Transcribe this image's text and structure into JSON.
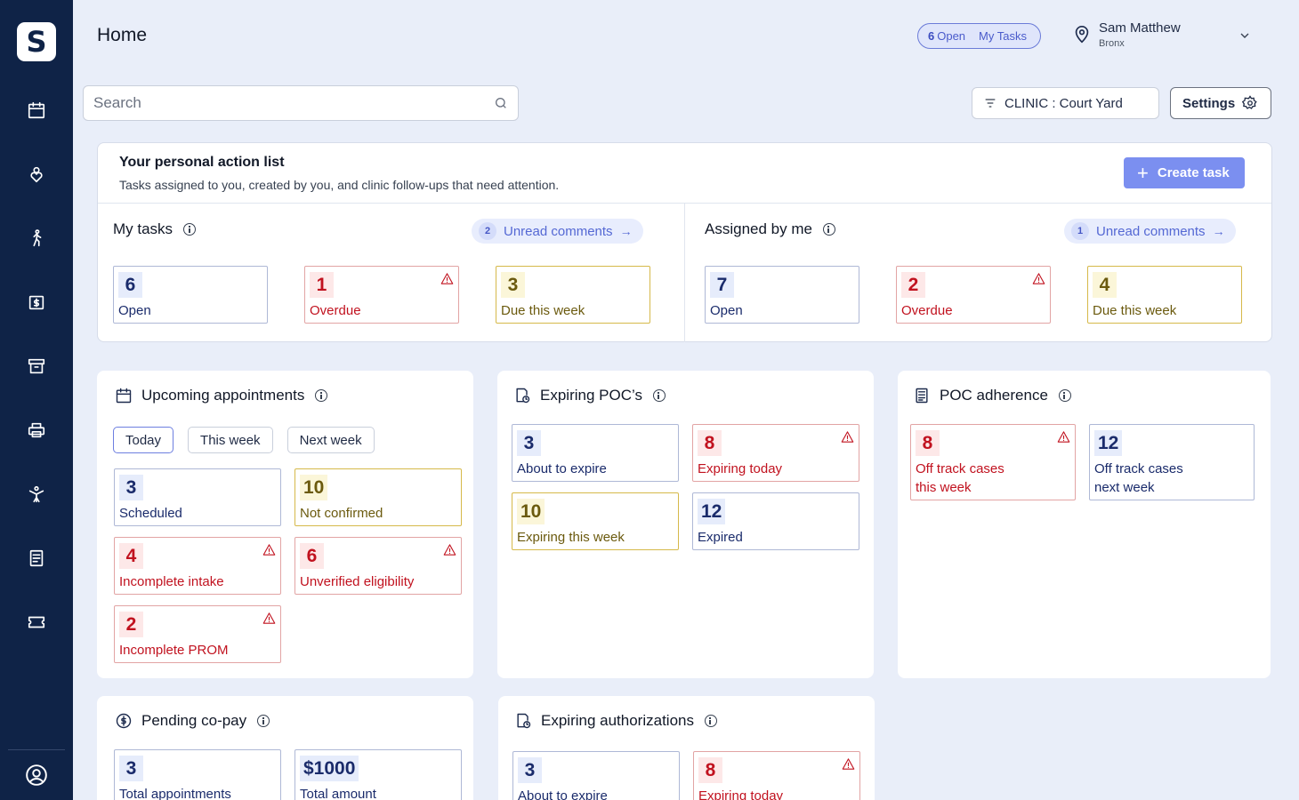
{
  "app": {
    "logo_letter": "S"
  },
  "sidebar": {
    "items": [
      {
        "icon": "calendar-icon"
      },
      {
        "icon": "patient-icon"
      },
      {
        "icon": "walking-person-icon"
      },
      {
        "icon": "billing-icon"
      },
      {
        "icon": "archive-icon"
      },
      {
        "icon": "printer-icon"
      },
      {
        "icon": "exercise-icon"
      },
      {
        "icon": "document-icon"
      },
      {
        "icon": "ticket-icon"
      }
    ],
    "profile_icon": "user-circle-icon"
  },
  "header": {
    "title": "Home",
    "tasks_count": "6",
    "tasks_open_label": "Open",
    "my_tasks_label": "My Tasks",
    "user_name": "Sam Matthew",
    "user_location": "Bronx"
  },
  "search": {
    "placeholder": "Search"
  },
  "filter": {
    "label": "CLINIC : Court Yard"
  },
  "settings": {
    "label": "Settings"
  },
  "action_list": {
    "title": "Your personal action list",
    "subtitle": "Tasks assigned to you, created by you, and clinic follow-ups that need attention.",
    "create_label": "Create task",
    "my_tasks": {
      "title": "My tasks",
      "unread_count": "2",
      "unread_label": "Unread comments",
      "open": {
        "value": "6",
        "label": "Open"
      },
      "overdue": {
        "value": "1",
        "label": "Overdue"
      },
      "due": {
        "value": "3",
        "label": "Due this week"
      }
    },
    "assigned": {
      "title": "Assigned by me",
      "unread_count": "1",
      "unread_label": "Unread comments",
      "open": {
        "value": "7",
        "label": "Open"
      },
      "overdue": {
        "value": "2",
        "label": "Overdue"
      },
      "due": {
        "value": "4",
        "label": "Due this week"
      }
    }
  },
  "appointments": {
    "title": "Upcoming appointments",
    "tabs": [
      "Today",
      "This week",
      "Next week"
    ],
    "scheduled": {
      "value": "3",
      "label": "Scheduled"
    },
    "not_confirmed": {
      "value": "10",
      "label": "Not confirmed"
    },
    "incomplete_intake": {
      "value": "4",
      "label": "Incomplete intake"
    },
    "unverified": {
      "value": "6",
      "label": "Unverified eligibility"
    },
    "incomplete_prom": {
      "value": "2",
      "label": "Incomplete PROM"
    }
  },
  "poc": {
    "title": "Expiring POC’s",
    "about": {
      "value": "3",
      "label": "About to expire"
    },
    "today": {
      "value": "8",
      "label": "Expiring today"
    },
    "week": {
      "value": "10",
      "label": "Expiring this week"
    },
    "expired": {
      "value": "12",
      "label": "Expired"
    }
  },
  "adherence": {
    "title": "POC adherence",
    "this_week": {
      "value": "8",
      "label_1": "Off track cases",
      "label_2": "this week"
    },
    "next_week": {
      "value": "12",
      "label_1": "Off track cases",
      "label_2": "next week"
    }
  },
  "copay": {
    "title": "Pending co-pay",
    "total_appts": {
      "value": "3",
      "label": "Total appointments"
    },
    "total_amount": {
      "value": "$1000",
      "label": "Total amount"
    }
  },
  "authorizations": {
    "title": "Expiring authorizations",
    "about": {
      "value": "3",
      "label": "About to expire"
    },
    "today": {
      "value": "8",
      "label": "Expiring today"
    }
  },
  "colors": {
    "sidebar": "#0f2347",
    "background": "#e9eef9",
    "accent": "#7b8ff0",
    "danger": "#c1121f",
    "warning": "#6b5a0e"
  }
}
